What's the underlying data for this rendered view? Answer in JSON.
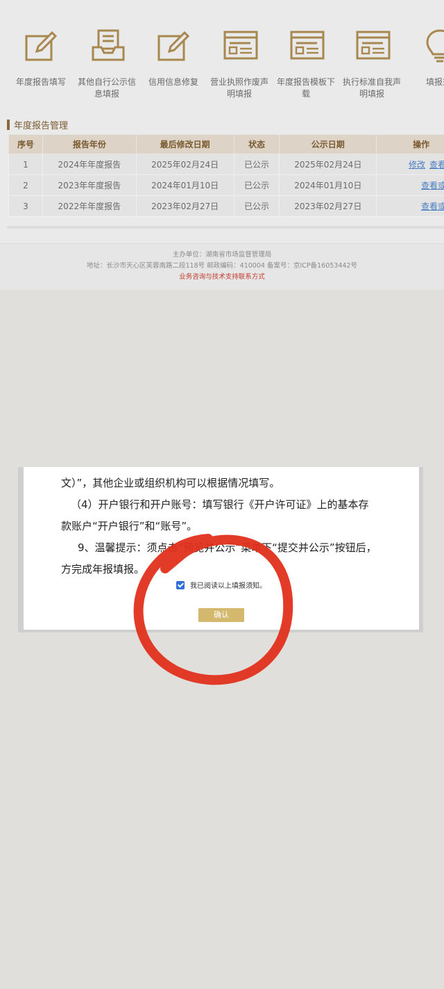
{
  "nav": {
    "items": [
      {
        "label": "年度报告填写",
        "icon": "edit-form-icon"
      },
      {
        "label": "其他自行公示信息填报",
        "icon": "inbox-document-icon"
      },
      {
        "label": "信用信息修复",
        "icon": "edit-form-icon"
      },
      {
        "label": "营业执照作废声明填报",
        "icon": "web-form-icon"
      },
      {
        "label": "年度报告模板下载",
        "icon": "web-form-icon"
      },
      {
        "label": "执行标准自我声明填报",
        "icon": "web-form-icon"
      },
      {
        "label": "填报须",
        "icon": "lightbulb-icon"
      }
    ]
  },
  "section": {
    "title": "年度报告管理"
  },
  "table": {
    "headers": [
      "序号",
      "报告年份",
      "最后修改日期",
      "状态",
      "公示日期",
      "操作"
    ],
    "rows": [
      {
        "no": "1",
        "year": "2024年年度报告",
        "modified": "2025年02月24日",
        "status": "已公示",
        "published": "2025年02月24日",
        "edit": "修改",
        "view": "查看或打"
      },
      {
        "no": "2",
        "year": "2023年年度报告",
        "modified": "2024年01月10日",
        "status": "已公示",
        "published": "2024年01月10日",
        "view": "查看或打印"
      },
      {
        "no": "3",
        "year": "2022年年度报告",
        "modified": "2023年02月27日",
        "status": "已公示",
        "published": "2023年02月27日",
        "view": "查看或打印"
      }
    ]
  },
  "footer": {
    "sponsor": "主办单位：湖南省市场监督管理局",
    "address": "地址：长沙市天心区芙蓉南路二段118号 邮政编码：410004 备案号：京ICP备16053442号",
    "support_link": "业务咨询与技术支持联系方式"
  },
  "modal": {
    "lines": [
      "文）”，其他企业或组织机构可以根据情况填写。",
      "（4）开户银行和开户账号：填写银行《开户许可证》上的基本存",
      "款账户“开户银行”和“账号”。",
      "9、温馨提示：须点击“预览并公示”菜单下“提交并公示”按钮后，",
      "方完成年报填报。"
    ],
    "agree_label": "我已阅读以上填报须知。",
    "agree_checked": true,
    "confirm_label": "确认"
  },
  "colors": {
    "icon_gold": "#a8884e",
    "header_text": "#7a5a30",
    "link_blue": "#4a7fc0",
    "footer_red": "#c23a2b",
    "confirm_gold": "#d4b86e",
    "annotation_red": "#e0321c"
  }
}
